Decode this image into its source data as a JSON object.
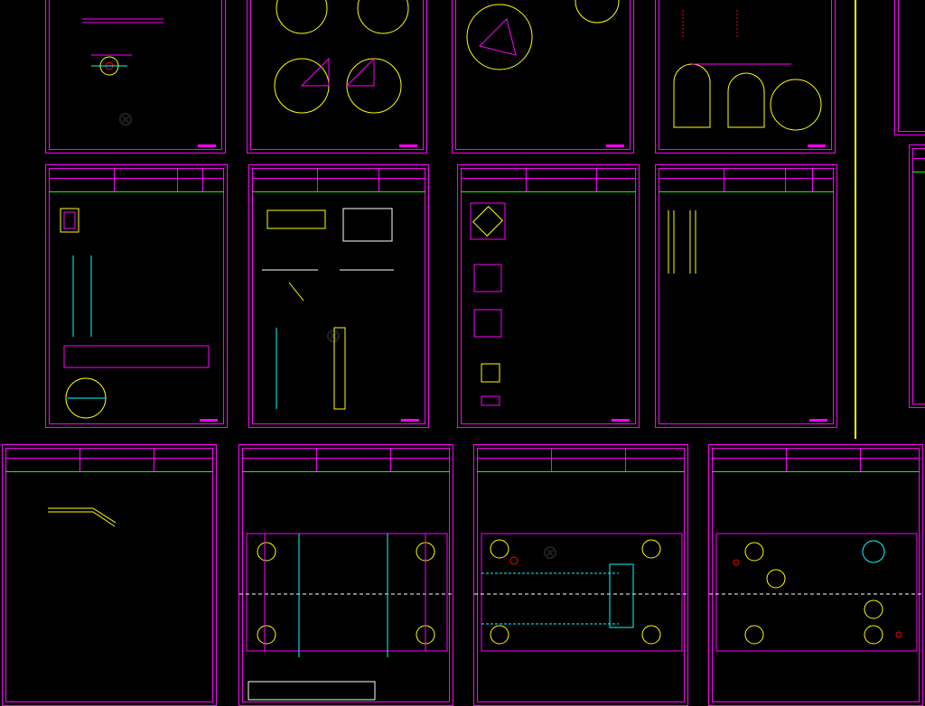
{
  "view": {
    "title": "",
    "background": "#000000",
    "colors": {
      "frame": "#ff00ff",
      "header_rule": "#00ff00",
      "text": "#ffffff",
      "dim": "#ffff00",
      "center": "#00ffff",
      "accent": "#ff2a2a"
    }
  },
  "sheets": [
    {
      "id": "s1",
      "header": {
        "c1": "",
        "c2": "",
        "c3": "",
        "c4": "",
        "c5": "",
        "c6": "",
        "c7": ""
      },
      "notes": [
        "",
        "",
        ""
      ]
    },
    {
      "id": "s2",
      "header": {
        "c1": "",
        "c2": "",
        "c3": "",
        "c4": "",
        "c5": "",
        "c6": "",
        "c7": ""
      },
      "notes": [
        "",
        "",
        ""
      ]
    },
    {
      "id": "s3",
      "header": {
        "c1": "",
        "c2": "",
        "c3": "",
        "c4": "",
        "c5": "",
        "c6": "",
        "c7": ""
      },
      "notes": [
        "",
        "",
        ""
      ]
    },
    {
      "id": "s4",
      "header": {
        "c1": "",
        "c2": "",
        "c3": "",
        "c4": "",
        "c5": "",
        "c6": "",
        "c7": ""
      },
      "notes": [
        "",
        "",
        ""
      ]
    },
    {
      "id": "s5",
      "header": {
        "c1": "",
        "c2": "",
        "c3": "",
        "c4": "",
        "c5": "",
        "c6": "",
        "c7": ""
      },
      "notes": [
        "",
        "",
        ""
      ]
    },
    {
      "id": "s6",
      "header": {
        "c1": "",
        "c2": "",
        "c3": "",
        "c4": "",
        "c5": "",
        "c6": "",
        "c7": ""
      },
      "notes": [
        "",
        "",
        ""
      ]
    },
    {
      "id": "s7",
      "header": {
        "c1": "",
        "c2": "",
        "c3": "",
        "c4": "",
        "c5": "",
        "c6": "",
        "c7": ""
      },
      "notes": [
        "",
        "",
        ""
      ]
    },
    {
      "id": "s8",
      "header": {
        "c1": "",
        "c2": "",
        "c3": "",
        "c4": "",
        "c5": "",
        "c6": "",
        "c7": ""
      },
      "notes": [
        "",
        "",
        ""
      ]
    },
    {
      "id": "s9",
      "header": {
        "c1": "",
        "c2": "",
        "c3": "",
        "c4": "",
        "c5": "",
        "c6": "",
        "c7": ""
      },
      "notes": [
        "",
        "",
        ""
      ]
    },
    {
      "id": "s10",
      "header": {
        "c1": "",
        "c2": "",
        "c3": "",
        "c4": "",
        "c5": "",
        "c6": "",
        "c7": ""
      },
      "notes": [
        "",
        "",
        ""
      ]
    },
    {
      "id": "s11",
      "header": {
        "c1": "",
        "c2": "",
        "c3": "",
        "c4": "",
        "c5": "",
        "c6": "",
        "c7": ""
      },
      "notes": [
        "",
        "",
        ""
      ]
    },
    {
      "id": "s12",
      "header": {
        "c1": "",
        "c2": "",
        "c3": "",
        "c4": "",
        "c5": "",
        "c6": "",
        "c7": ""
      },
      "notes": [
        "",
        "",
        ""
      ]
    },
    {
      "id": "s13",
      "header": {
        "c1": "",
        "c2": "",
        "c3": "",
        "c4": "",
        "c5": "",
        "c6": "",
        "c7": ""
      },
      "notes": [
        "",
        "",
        ""
      ]
    }
  ],
  "bottom_labels": {
    "left": "",
    "middle": ""
  }
}
